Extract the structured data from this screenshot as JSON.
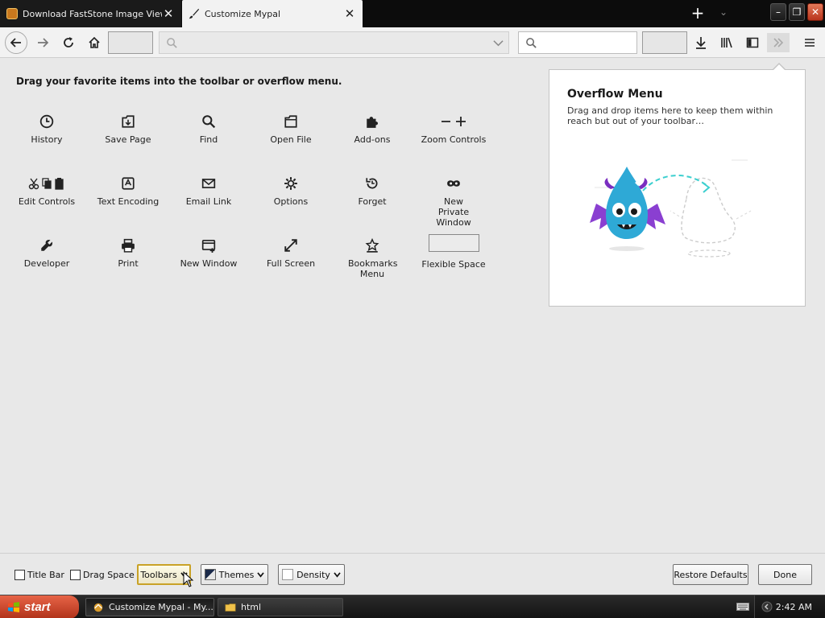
{
  "tabs": [
    {
      "title": "Download FastStone Image Viewer",
      "active": false
    },
    {
      "title": "Customize Mypal",
      "active": true
    }
  ],
  "heading": "Drag your favorite items into the toolbar or overflow menu.",
  "palette": [
    {
      "label": "History",
      "icon": "clock-icon"
    },
    {
      "label": "Save Page",
      "icon": "save-page-icon"
    },
    {
      "label": "Find",
      "icon": "magnifier-icon"
    },
    {
      "label": "Open File",
      "icon": "folder-icon"
    },
    {
      "label": "Add-ons",
      "icon": "puzzle-icon"
    },
    {
      "label": "Zoom Controls",
      "icon": "zoom-icon"
    },
    {
      "label": "Edit Controls",
      "icon": "edit-icon"
    },
    {
      "label": "Text Encoding",
      "icon": "encoding-icon"
    },
    {
      "label": "Email Link",
      "icon": "envelope-icon"
    },
    {
      "label": "Options",
      "icon": "gear-icon"
    },
    {
      "label": "Forget",
      "icon": "forget-icon"
    },
    {
      "label": "New Private Window",
      "icon": "mask-icon"
    },
    {
      "label": "Developer",
      "icon": "wrench-icon"
    },
    {
      "label": "Print",
      "icon": "printer-icon"
    },
    {
      "label": "New Window",
      "icon": "new-window-icon"
    },
    {
      "label": "Full Screen",
      "icon": "fullscreen-icon"
    },
    {
      "label": "Bookmarks Menu",
      "icon": "bookmarks-star-icon"
    },
    {
      "label": "Flexible Space",
      "icon": "flexible-space-box"
    }
  ],
  "overflow": {
    "title": "Overflow Menu",
    "description": "Drag and drop items here to keep them within reach but out of your toolbar…"
  },
  "footer": {
    "title_bar": "Title Bar",
    "drag_space": "Drag Space",
    "toolbars": "Toolbars",
    "themes": "Themes",
    "density": "Density",
    "restore_defaults": "Restore Defaults",
    "done": "Done"
  },
  "taskbar": {
    "start": "start",
    "tasks": [
      {
        "label": "Customize Mypal - My...",
        "active": true
      },
      {
        "label": "html",
        "active": false
      }
    ],
    "clock": "2:42 AM"
  }
}
